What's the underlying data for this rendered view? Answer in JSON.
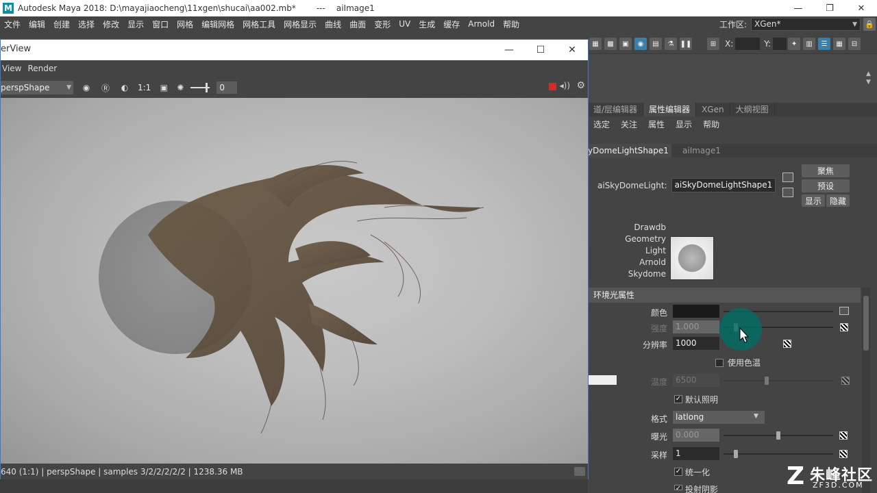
{
  "app": {
    "title": "Autodesk Maya 2018: D:\\mayajiaocheng\\11xgen\\shucai\\aa002.mb*",
    "separator": "---",
    "node": "aiImage1",
    "logo": "M"
  },
  "menubar": [
    "文件",
    "编辑",
    "创建",
    "选择",
    "修改",
    "显示",
    "窗口",
    "网格",
    "编辑网格",
    "网格工具",
    "网格显示",
    "曲线",
    "曲面",
    "变形",
    "UV",
    "生成",
    "缓存",
    "Arnold",
    "帮助"
  ],
  "workspace": {
    "label": "工作区:",
    "value": "XGen*"
  },
  "toolrow": {
    "x_label": "X:",
    "y_label": "Y:"
  },
  "panel": {
    "tabs": [
      "道/层编辑器",
      "属性编辑器",
      "XGen",
      "大纲视图"
    ],
    "active_tab": 1,
    "menu": [
      "选定",
      "关注",
      "属性",
      "显示",
      "帮助"
    ],
    "node_tabs": [
      "yDomeLightShape1",
      "aiImage1"
    ],
    "node_label": "aiSkyDomeLight:",
    "node_value": "aiSkyDomeLightShape1",
    "focus_btn": "聚焦",
    "preset_btn": "预设",
    "show_btn": "显示",
    "hide_btn": "隐藏",
    "classifications": [
      "Drawdb",
      "Geometry",
      "Light",
      "Arnold",
      "Skydome"
    ],
    "section_title": "环境光属性",
    "color_label": "颜色",
    "intensity_label": "强度",
    "intensity_value": "1.000",
    "resolution_label": "分辨率",
    "resolution_value": "1000",
    "use_color_temp_label": "使用色温",
    "temperature_label": "温度",
    "temperature_value": "6500",
    "default_lighting_label": "默认照明",
    "format_label": "格式",
    "format_value": "latlong",
    "exposure_label": "曝光",
    "exposure_value": "0.000",
    "samples_label": "采样",
    "samples_value": "1",
    "normalize_label": "统一化",
    "cast_shadows_label": "投射阴影"
  },
  "renderview": {
    "title": "erView",
    "menu": [
      "View",
      "Render"
    ],
    "camera": "perspShape",
    "ratio": "1:1",
    "exposure_value": "0",
    "status": "640 (1:1)  |  perspShape  |  samples 3/2/2/2/2/2  |  1238.36 MB"
  },
  "watermark": {
    "text": "朱峰社区",
    "sub": "ZF3D.COM"
  },
  "colors": {
    "accent": "#3a7cc0",
    "cursor_ring": "#006e64",
    "stop": "#d42a2a"
  }
}
